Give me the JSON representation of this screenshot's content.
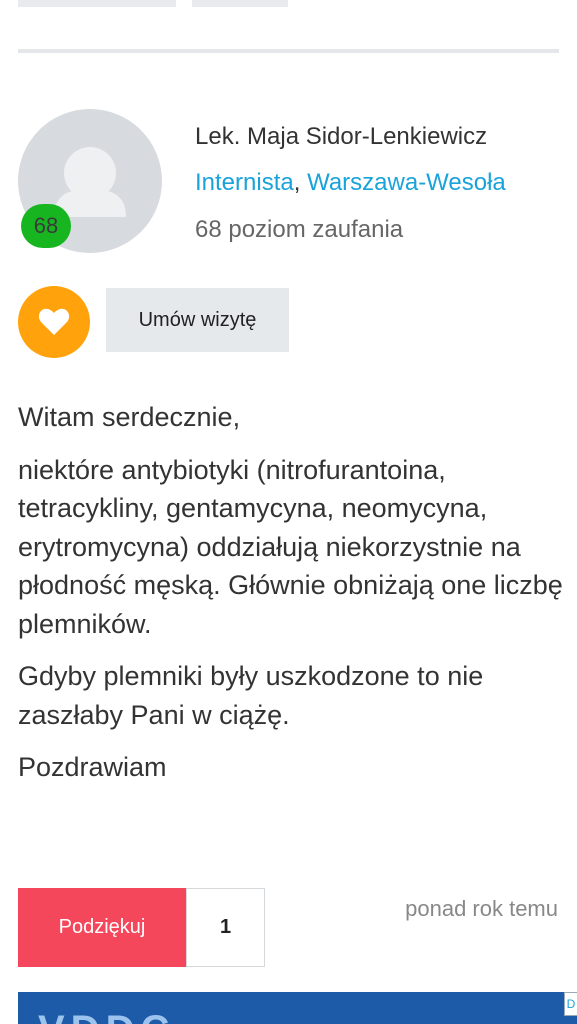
{
  "doctor": {
    "name": "Lek. Maja Sidor-Lenkiewicz",
    "specialty": "Internista",
    "separator": ",",
    "location": "Warszawa-Wesoła",
    "trust_score": "68",
    "trust_label": "68 poziom zaufania"
  },
  "actions": {
    "book_label": "Umów wizytę",
    "favorite_icon": "heart-icon"
  },
  "answer": {
    "paragraphs": [
      "Witam serdecznie,",
      "niektóre antybiotyki (nitrofurantoina, tetracykliny, gentamycyna, neomycyna, erytromycyna) oddziałują niekorzystnie na płodność męską. Głównie obniżają one liczbę plemników.",
      "Gdyby plemniki były uszkodzone to nie zaszłaby Pani w ciążę.",
      "Pozdrawiam"
    ]
  },
  "footer": {
    "thanks_label": "Podziękuj",
    "thanks_count": "1",
    "time_ago": "ponad rok temu"
  },
  "ad": {
    "visible_text": "VDDC",
    "marker": "D"
  },
  "colors": {
    "accent_link": "#1aa3db",
    "trust_badge": "#17b620",
    "favorite": "#ffa20b",
    "thanks_button": "#f5475c"
  }
}
